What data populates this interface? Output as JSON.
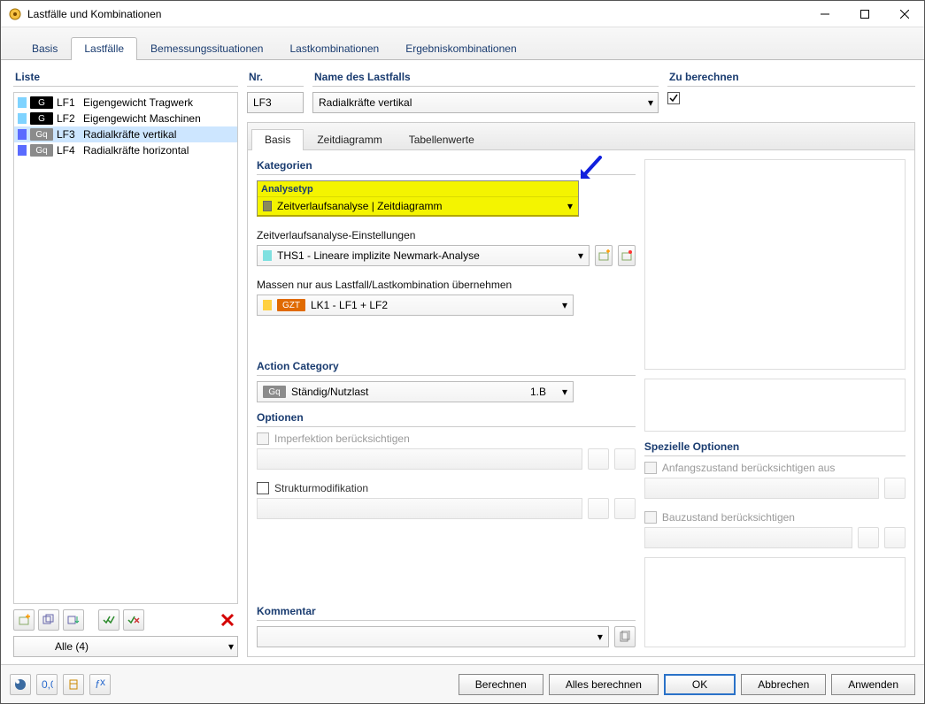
{
  "window": {
    "title": "Lastfälle und Kombinationen"
  },
  "mainTabs": [
    "Basis",
    "Lastfälle",
    "Bemessungssituationen",
    "Lastkombinationen",
    "Ergebniskombinationen"
  ],
  "mainTabActive": 1,
  "left": {
    "title": "Liste",
    "items": [
      {
        "swatch": "#7fd3ff",
        "badge": "G",
        "badgeBg": "#000",
        "id": "LF1",
        "name": "Eigengewicht Tragwerk"
      },
      {
        "swatch": "#7fd3ff",
        "badge": "G",
        "badgeBg": "#000",
        "id": "LF2",
        "name": "Eigengewicht Maschinen"
      },
      {
        "swatch": "#5a6bff",
        "badge": "Gq",
        "badgeBg": "#8b8b8b",
        "id": "LF3",
        "name": "Radialkräfte vertikal",
        "sel": true
      },
      {
        "swatch": "#5a6bff",
        "badge": "Gq",
        "badgeBg": "#8b8b8b",
        "id": "LF4",
        "name": "Radialkräfte horizontal"
      }
    ],
    "filter": "Alle (4)"
  },
  "hdr": {
    "nrLabel": "Nr.",
    "nr": "LF3",
    "nameLabel": "Name des Lastfalls",
    "name": "Radialkräfte vertikal",
    "calcLabel": "Zu berechnen",
    "calc": true
  },
  "subTabs": [
    "Basis",
    "Zeitdiagramm",
    "Tabellenwerte"
  ],
  "subTabActive": 0,
  "kategorien": {
    "title": "Kategorien",
    "analyseTypLabel": "Analysetyp",
    "analyseTyp": "Zeitverlaufsanalyse | Zeitdiagramm",
    "zveLabel": "Zeitverlaufsanalyse-Einstellungen",
    "zve": "THS1 - Lineare implizite Newmark-Analyse",
    "massLabel": "Massen nur aus Lastfall/Lastkombination übernehmen",
    "massBadge": "GZT",
    "mass": "LK1 - LF1 + LF2"
  },
  "actionCat": {
    "title": "Action Category",
    "badge": "Gq",
    "name": "Ständig/Nutzlast",
    "val": "1.B"
  },
  "optionen": {
    "title": "Optionen",
    "imp": "Imperfektion berücksichtigen",
    "struct": "Strukturmodifikation"
  },
  "spez": {
    "title": "Spezielle Optionen",
    "anf": "Anfangszustand berücksichtigen aus",
    "bau": "Bauzustand berücksichtigen"
  },
  "kommentar": {
    "title": "Kommentar"
  },
  "footer": {
    "berechnen": "Berechnen",
    "alles": "Alles berechnen",
    "ok": "OK",
    "abbr": "Abbrechen",
    "anw": "Anwenden"
  }
}
